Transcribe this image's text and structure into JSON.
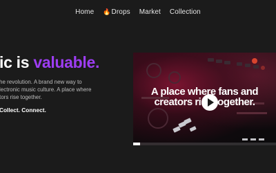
{
  "nav": {
    "items": [
      "Home",
      "Drops",
      "Market",
      "Collection"
    ],
    "drops_icon": "fire-icon"
  },
  "hero": {
    "title_part1": "ic is ",
    "title_accent": "valuable.",
    "accent_color": "#9d3df2",
    "body_lines": [
      "he revolution. A brand new way to",
      "lectronic music culture. A place where",
      "tors rise together."
    ],
    "tagline": "Collect. Connect."
  },
  "video": {
    "caption_line1": "A place where fans and",
    "caption_line2": "creators rise together.",
    "play_icon": "play-icon",
    "progress": 0.05
  }
}
